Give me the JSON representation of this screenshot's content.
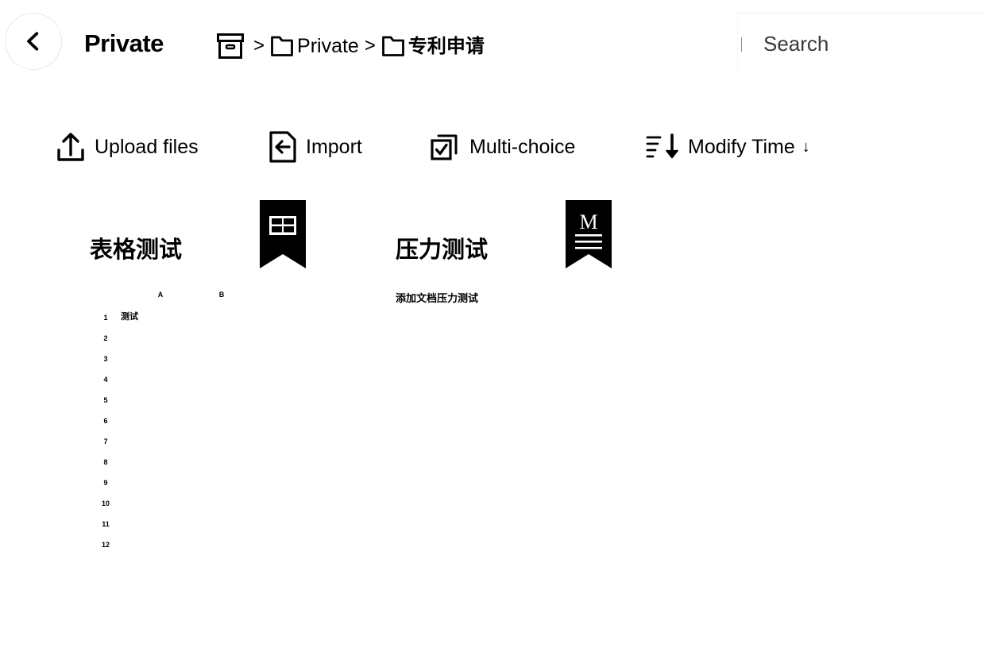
{
  "header": {
    "back_icon": "chevron-left-icon",
    "title": "Private",
    "breadcrumb": [
      {
        "icon": "archive-box-icon",
        "label": "",
        "separator": ">"
      },
      {
        "icon": "folder-icon",
        "label": "Private",
        "separator": ">"
      },
      {
        "icon": "folder-icon",
        "label": "专利申请",
        "separator": ""
      }
    ],
    "search": {
      "placeholder": "Search",
      "value": ""
    }
  },
  "toolbar": {
    "items": [
      {
        "id": "upload",
        "icon": "upload-tray-icon",
        "label": "Upload files"
      },
      {
        "id": "import",
        "icon": "document-import-icon",
        "label": "Import"
      },
      {
        "id": "multi",
        "icon": "checkbox-stack-icon",
        "label": "Multi-choice"
      },
      {
        "id": "sort",
        "icon": "sort-descending-icon",
        "label": "Modify Time",
        "arrow": "↓"
      }
    ]
  },
  "files": [
    {
      "title": "表格测试",
      "subtitle": "",
      "badge": "table-bookmark-icon",
      "preview": {
        "type": "spreadsheet",
        "columns": [
          "A",
          "B"
        ],
        "rows": [
          {
            "num": "1",
            "cells": [
              "测试",
              ""
            ]
          },
          {
            "num": "2",
            "cells": [
              "",
              ""
            ]
          },
          {
            "num": "3",
            "cells": [
              "",
              ""
            ]
          },
          {
            "num": "4",
            "cells": [
              "",
              ""
            ]
          },
          {
            "num": "5",
            "cells": [
              "",
              ""
            ]
          },
          {
            "num": "6",
            "cells": [
              "",
              ""
            ]
          },
          {
            "num": "7",
            "cells": [
              "",
              ""
            ]
          },
          {
            "num": "8",
            "cells": [
              "",
              ""
            ]
          },
          {
            "num": "9",
            "cells": [
              "",
              ""
            ]
          },
          {
            "num": "10",
            "cells": [
              "",
              ""
            ]
          },
          {
            "num": "11",
            "cells": [
              "",
              ""
            ]
          },
          {
            "num": "12",
            "cells": [
              "",
              ""
            ]
          }
        ]
      }
    },
    {
      "title": "压力测试",
      "subtitle": "添加文档压力测试",
      "badge": "markdown-bookmark-icon",
      "preview": {
        "type": "text"
      }
    }
  ],
  "colors": {
    "background": "#ffffff",
    "foreground": "#000000",
    "placeholder": "#3a3a3a",
    "hairline": "#e3e3e3"
  }
}
